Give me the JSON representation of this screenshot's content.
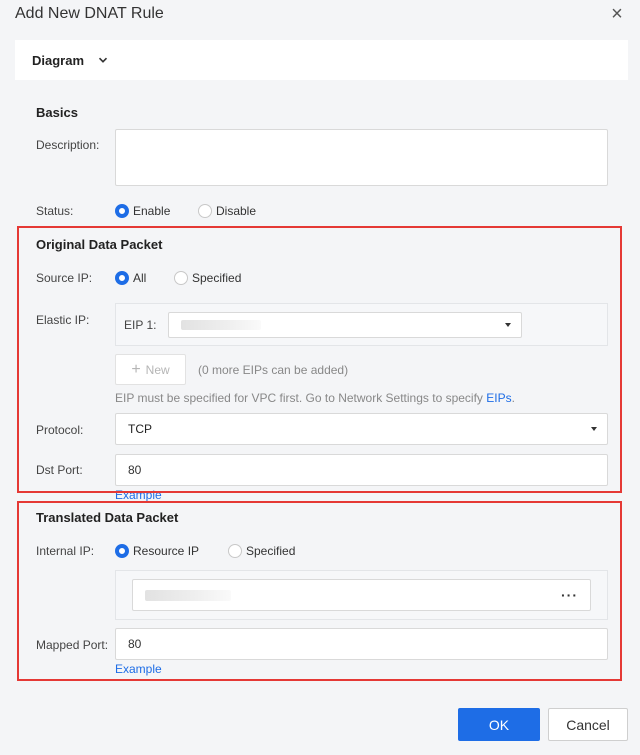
{
  "dialog": {
    "title": "Add New DNAT Rule",
    "close_icon": "close-icon"
  },
  "diagram": {
    "label": "Diagram",
    "toggle_icon": "chevron-down-icon"
  },
  "basics": {
    "title": "Basics",
    "description_label": "Description:",
    "description_value": "",
    "status_label": "Status:",
    "status_options": [
      "Enable",
      "Disable"
    ],
    "status_selected": "Enable"
  },
  "original": {
    "title": "Original Data Packet",
    "source_ip_label": "Source IP:",
    "source_ip_options": [
      "All",
      "Specified"
    ],
    "source_ip_selected": "All",
    "elastic_ip_label": "Elastic IP:",
    "eip1_label": "EIP 1:",
    "new_button": "New",
    "more_eips_note": "(0 more EIPs can be added)",
    "eip_hint": "EIP must be specified for VPC first. Go to Network Settings to specify ",
    "eip_hint_link": "EIPs",
    "eip_hint_end": ".",
    "protocol_label": "Protocol:",
    "protocol_value": "TCP",
    "dst_port_label": "Dst Port:",
    "dst_port_value": "80",
    "example_link": "Example"
  },
  "translated": {
    "title": "Translated Data Packet",
    "internal_ip_label": "Internal IP:",
    "internal_ip_options": [
      "Resource IP",
      "Specified"
    ],
    "internal_ip_selected": "Resource IP",
    "resource_more_icon": "ellipsis-icon",
    "mapped_port_label": "Mapped Port:",
    "mapped_port_value": "80",
    "example_link": "Example"
  },
  "footer": {
    "ok_label": "OK",
    "cancel_label": "Cancel"
  },
  "colors": {
    "accent": "#1e6de6",
    "highlight_border": "#e53935"
  }
}
